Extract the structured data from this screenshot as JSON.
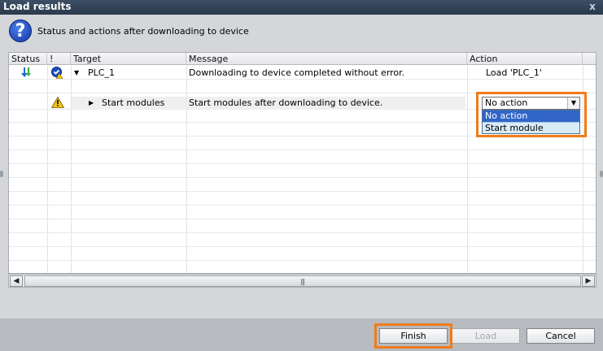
{
  "window": {
    "title": "Load results",
    "close_glyph": "x"
  },
  "header": {
    "text": "Status and actions after downloading to device",
    "icon": "help-question-icon"
  },
  "columns": {
    "status": "Status",
    "flag": "!",
    "target": "Target",
    "message": "Message",
    "action": "Action"
  },
  "rows": [
    {
      "target": "PLC_1",
      "message": "Downloading to device completed without error.",
      "action": "Load 'PLC_1'",
      "status_icon": "download-arrow-icon",
      "flag_icon": "check-warning-icon",
      "expander": "▼"
    },
    {
      "target": "Start modules",
      "message": "Start modules after downloading to device.",
      "flag_icon": "warning-icon",
      "expander": "▶"
    }
  ],
  "action_select": {
    "value": "No action",
    "options": [
      "No action",
      "Start module"
    ],
    "highlighted_option": "No action"
  },
  "scrollbar": {
    "grip": "|||",
    "left": "◀",
    "right": "▶"
  },
  "buttons": {
    "finish": "Finish",
    "load": "Load",
    "cancel": "Cancel"
  },
  "colors": {
    "highlight": "#f07b17",
    "selection": "#3166c8",
    "warning": "#e9c400"
  }
}
